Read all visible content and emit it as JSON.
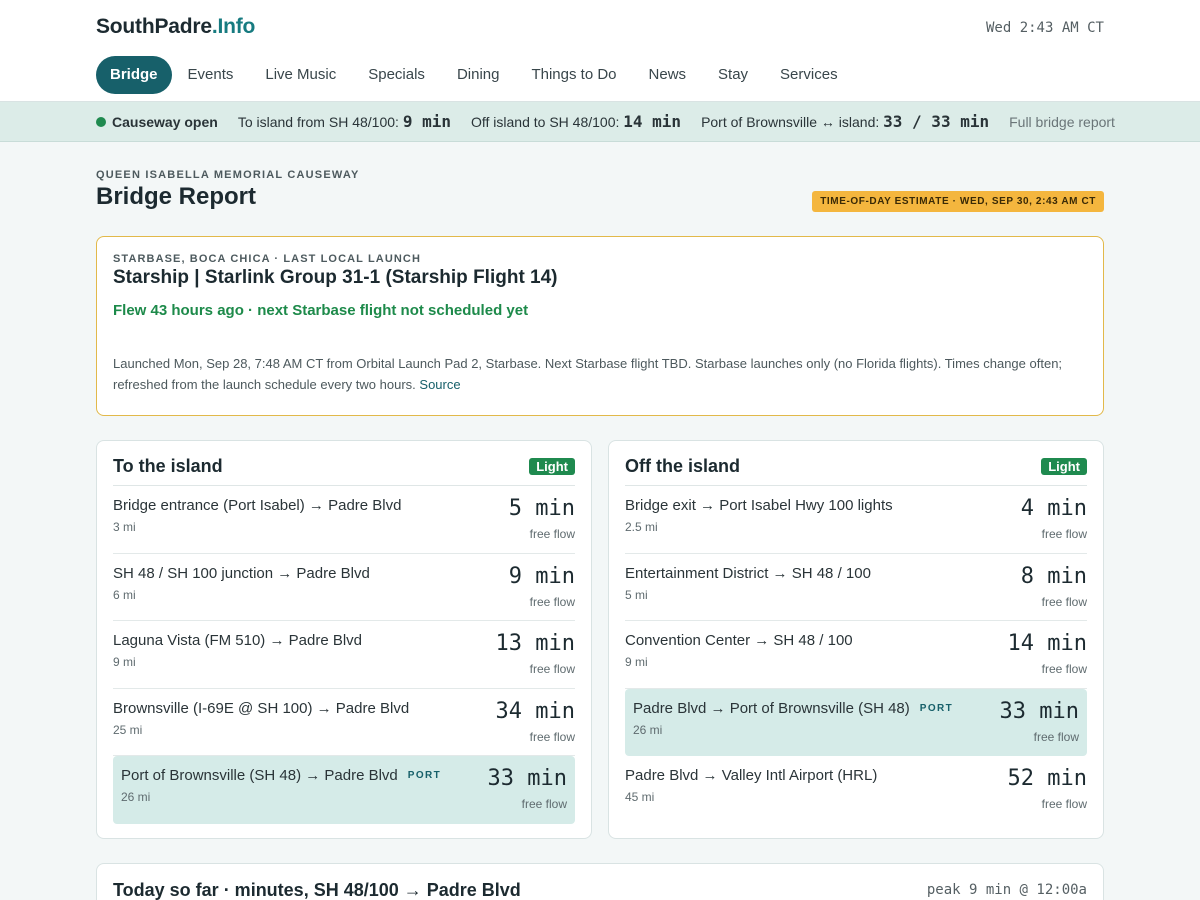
{
  "header": {
    "logo_main": "SouthPadre",
    "logo_tld": ".Info",
    "clock": "Wed 2:43 AM CT",
    "nav": [
      "Bridge",
      "Events",
      "Live Music",
      "Specials",
      "Dining",
      "Things to Do",
      "News",
      "Stay",
      "Services"
    ],
    "active_nav": "Bridge"
  },
  "status": {
    "state": "Causeway open",
    "to_island_label": "To island from SH 48/100:",
    "to_island_value": "9 min",
    "off_island_label": "Off island to SH 48/100:",
    "off_island_value": "14 min",
    "port_label": "Port of Brownsville ↔ island:",
    "port_value": "33 / 33 min",
    "report_link": "Full bridge report",
    "state_color": "#1f8a4f"
  },
  "page": {
    "eyebrow": "QUEEN ISABELLA MEMORIAL CAUSEWAY",
    "title": "Bridge Report",
    "estimate_badge": "TIME-OF-DAY ESTIMATE · WED, SEP 30, 2:43 AM CT"
  },
  "launch": {
    "eyebrow": "STARBASE, BOCA CHICA · LAST LOCAL LAUNCH",
    "mission": "Starship | Starlink Group 31-1 (Starship Flight 14)",
    "flew": "Flew 43 hours ago · next Starbase flight not scheduled yet",
    "detail": "Launched Mon, Sep 28, 7:48 AM CT from Orbital Launch Pad 2, Starbase. Next Starbase flight TBD. Starbase launches only (no Florida flights). Times change often; refreshed from the launch schedule every two hours.",
    "source_link": "Source"
  },
  "to_island": {
    "title": "To the island",
    "traffic": "Light",
    "routes": [
      {
        "name": "Bridge entrance (Port Isabel) → Padre Blvd",
        "dist": "3 mi",
        "mins": "5 min",
        "flow": "free flow",
        "tag": ""
      },
      {
        "name": "SH 48 / SH 100 junction → Padre Blvd",
        "dist": "6 mi",
        "mins": "9 min",
        "flow": "free flow",
        "tag": ""
      },
      {
        "name": "Laguna Vista (FM 510) → Padre Blvd",
        "dist": "9 mi",
        "mins": "13 min",
        "flow": "free flow",
        "tag": ""
      },
      {
        "name": "Brownsville (I-69E @ SH 100) → Padre Blvd",
        "dist": "25 mi",
        "mins": "34 min",
        "flow": "free flow",
        "tag": ""
      },
      {
        "name": "Port of Brownsville (SH 48) → Padre Blvd",
        "dist": "26 mi",
        "mins": "33 min",
        "flow": "free flow",
        "tag": "PORT"
      }
    ]
  },
  "off_island": {
    "title": "Off the island",
    "traffic": "Light",
    "routes": [
      {
        "name": "Bridge exit → Port Isabel Hwy 100 lights",
        "dist": "2.5 mi",
        "mins": "4 min",
        "flow": "free flow",
        "tag": ""
      },
      {
        "name": "Entertainment District → SH 48 / 100",
        "dist": "5 mi",
        "mins": "8 min",
        "flow": "free flow",
        "tag": ""
      },
      {
        "name": "Convention Center → SH 48 / 100",
        "dist": "9 mi",
        "mins": "14 min",
        "flow": "free flow",
        "tag": ""
      },
      {
        "name": "Padre Blvd → Port of Brownsville (SH 48)",
        "dist": "26 mi",
        "mins": "33 min",
        "flow": "free flow",
        "tag": "PORT"
      },
      {
        "name": "Padre Blvd → Valley Intl Airport (HRL)",
        "dist": "45 mi",
        "mins": "52 min",
        "flow": "free flow",
        "tag": ""
      }
    ]
  },
  "today": {
    "title": "Today so far · minutes, SH 48/100 → Padre Blvd",
    "peak": "peak 9 min @ 12:00a"
  }
}
